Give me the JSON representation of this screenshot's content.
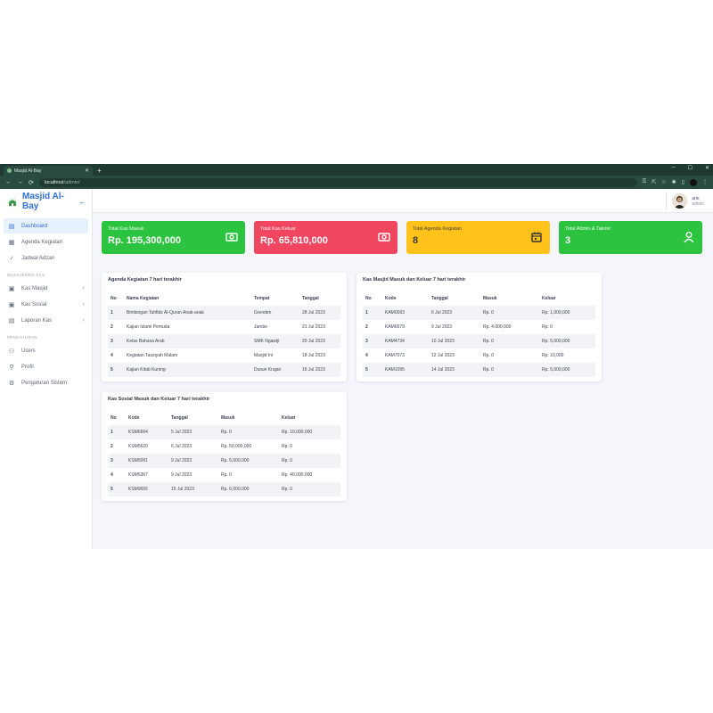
{
  "browser": {
    "tab_title": "Masjid Al-Bay",
    "url_host": "localhost",
    "url_path": "/admin/"
  },
  "brand": {
    "name": "Masjid Al-Bay"
  },
  "sidebar": {
    "items_top": [
      {
        "label": "Dashboard",
        "icon": "calendar-icon",
        "active": true
      },
      {
        "label": "Agenda Kegiatan",
        "icon": "document-icon"
      },
      {
        "label": "Jadwal Adzan",
        "icon": "microphone-icon"
      }
    ],
    "section_kas": "MANAJEMEN KAS",
    "items_kas": [
      {
        "label": "Kas Masjid",
        "icon": "cash-icon"
      },
      {
        "label": "Kas Sosial",
        "icon": "cash-icon"
      },
      {
        "label": "Laporan Kas",
        "icon": "document-icon"
      }
    ],
    "section_pengaturan": "PENGATURAN",
    "items_pengaturan": [
      {
        "label": "Users",
        "icon": "users-icon"
      },
      {
        "label": "Profil",
        "icon": "user-icon"
      },
      {
        "label": "Pengaturan Sistem",
        "icon": "gear-icon"
      }
    ]
  },
  "user": {
    "name": "arie",
    "role": "admin"
  },
  "cards": [
    {
      "label": "Total Kas Masuk",
      "value": "Rp. 195,300,000",
      "color": "#2bc33f",
      "icon": "money-icon"
    },
    {
      "label": "Total Kas Keluar",
      "value": "Rp. 65,810,000",
      "color": "#f0465f",
      "icon": "money-icon"
    },
    {
      "label": "Total Agenda Kegiatan",
      "value": "8",
      "color": "#ffc21a",
      "icon": "calendar-icon"
    },
    {
      "label": "Total Admin & Takmir",
      "value": "3",
      "color": "#2bc33f",
      "icon": "user-icon"
    }
  ],
  "agenda": {
    "title": "Agenda Kegiatan 7 hari terakhir",
    "headers": [
      "No",
      "Nama Kegiatan",
      "Tempat",
      "Tanggal"
    ],
    "rows": [
      [
        "1",
        "Bimbingan Tahfidz Al-Quran Anak-anak",
        "Grenden",
        "28 Jul 2023"
      ],
      [
        "2",
        "Kajian Islami Pemuda",
        "Jambe",
        "21 Jul 2023"
      ],
      [
        "3",
        "Kelas Bahasa Arab",
        "SMK Ngawiji",
        "20 Jul 2023"
      ],
      [
        "4",
        "Kegiatan Tausiyah Malam",
        "Masjid Ini",
        "18 Jul 2023"
      ],
      [
        "5",
        "Kajian Kitab Kuning",
        "Dusun Krajan",
        "16 Jul 2023"
      ]
    ]
  },
  "kas_masjid": {
    "title": "Kas Masjid Masuk dan Keluar 7 hari terakhir",
    "headers": [
      "No",
      "Kode",
      "Tanggal",
      "Masuk",
      "Keluar"
    ],
    "rows": [
      [
        "1",
        "KAM0093",
        "6 Jul 2023",
        "Rp. 0",
        "Rp. 1,000,000"
      ],
      [
        "2",
        "KAM6679",
        "9 Jul 2023",
        "Rp. 4,000,000",
        "Rp. 0"
      ],
      [
        "3",
        "KAM4734",
        "10 Jul 2023",
        "Rp. 0",
        "Rp. 5,000,000"
      ],
      [
        "4",
        "KAM7073",
        "12 Jul 2023",
        "Rp. 0",
        "Rp. 10,000"
      ],
      [
        "5",
        "KAM1095",
        "14 Jul 2023",
        "Rp. 0",
        "Rp. 5,000,000"
      ]
    ]
  },
  "kas_sosial": {
    "title": "Kas Sosial Masuk dan Keluar 7 hari terakhir",
    "headers": [
      "No",
      "Kode",
      "Tanggal",
      "Masuk",
      "Keluar"
    ],
    "rows": [
      [
        "1",
        "KSM6664",
        "5 Jul 2023",
        "Rp. 0",
        "Rp. 10,000,000"
      ],
      [
        "2",
        "KSM5620",
        "6 Jul 2023",
        "Rp. 50,000,000",
        "Rp. 0"
      ],
      [
        "3",
        "KSM5091",
        "9 Jul 2023",
        "Rp. 5,000,000",
        "Rp. 0"
      ],
      [
        "4",
        "KSM5367",
        "9 Jul 2023",
        "Rp. 0",
        "Rp. 40,000,000"
      ],
      [
        "5",
        "KSM9656",
        "15 Jul 2023",
        "Rp. 6,000,000",
        "Rp. 0"
      ]
    ]
  }
}
